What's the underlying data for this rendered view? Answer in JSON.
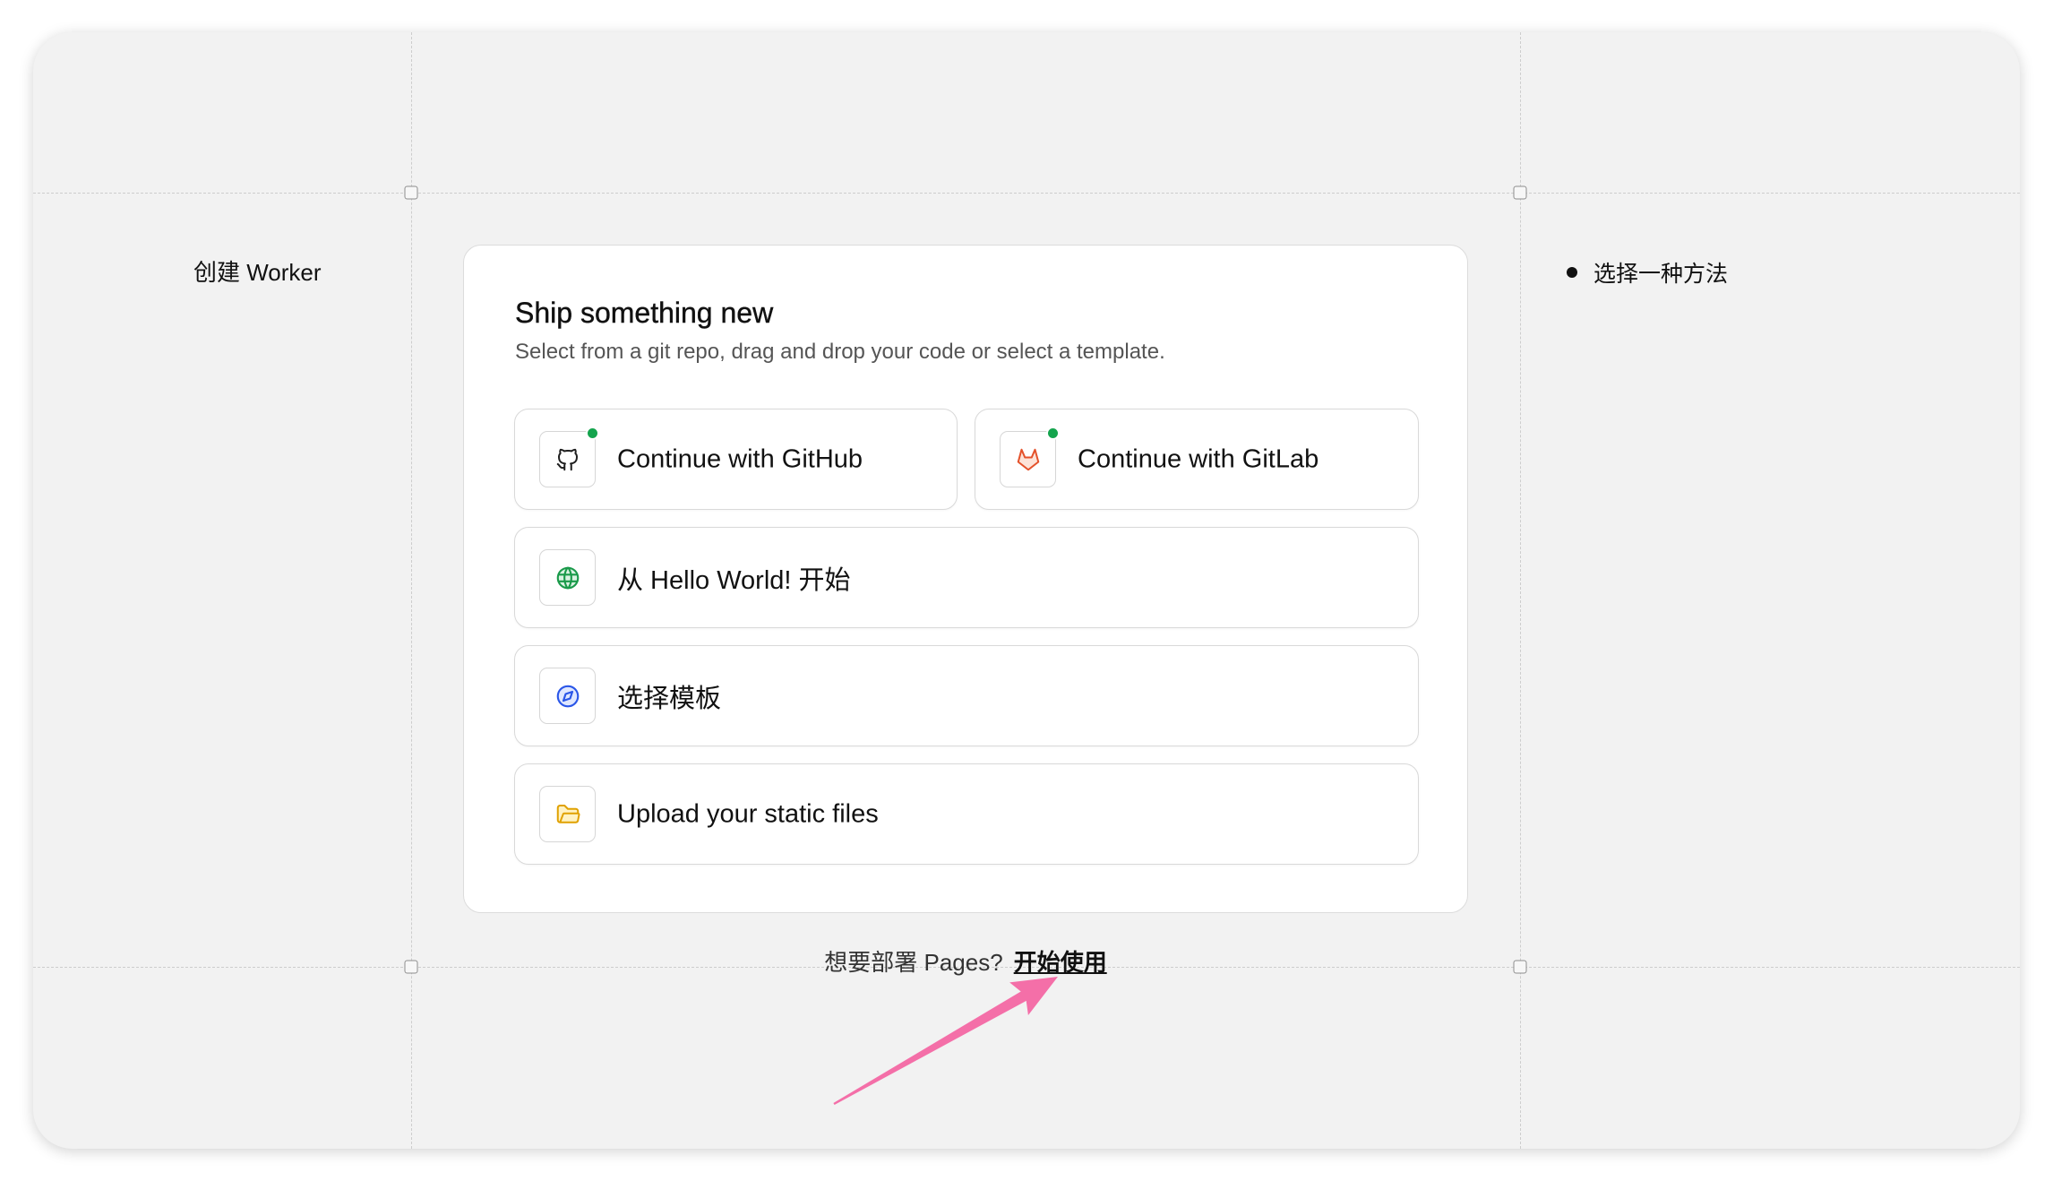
{
  "panel": {
    "left_label": "创建 Worker",
    "steps": [
      "选择一种方法"
    ]
  },
  "card": {
    "title": "Ship something new",
    "subtitle": "Select from a git repo, drag and drop your code or select a template.",
    "options": [
      {
        "label": "Continue with GitHub",
        "icon": "github-icon",
        "status_dot": true
      },
      {
        "label": "Continue with GitLab",
        "icon": "gitlab-icon",
        "status_dot": true
      },
      {
        "label": "从 Hello World! 开始",
        "icon": "globe-icon",
        "status_dot": false
      },
      {
        "label": "选择模板",
        "icon": "compass-icon",
        "status_dot": false
      },
      {
        "label": "Upload your static files",
        "icon": "folder-open-icon",
        "status_dot": false
      }
    ]
  },
  "footer": {
    "prompt": "想要部署 Pages?",
    "link": "开始使用"
  },
  "colors": {
    "status_dot": "#14a44d",
    "github": "#1f1f1f",
    "gitlab": "#e4522b",
    "globe": "#1a9a4a",
    "compass": "#2a56e8",
    "folder": "#e0a100",
    "annotation_arrow": "#f46fa8"
  }
}
